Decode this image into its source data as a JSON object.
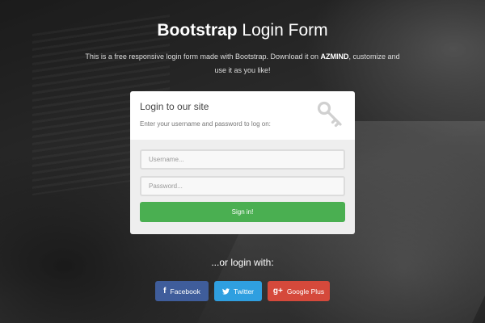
{
  "header": {
    "title_bold": "Bootstrap",
    "title_light": " Login Form",
    "description_prefix": "This is a free responsive login form made with Bootstrap. Download it on ",
    "description_brand": "AZMIND",
    "description_suffix": ", customize and use it as you like!"
  },
  "form": {
    "heading": "Login to our site",
    "subheading": "Enter your username and password to log on:",
    "icon": "key-icon",
    "username_placeholder": "Username...",
    "password_placeholder": "Password...",
    "submit_label": "Sign in!",
    "submit_color": "#4aaf51"
  },
  "social": {
    "label": "...or login with:",
    "buttons": [
      {
        "label": "Facebook",
        "icon": "facebook-icon",
        "color": "#3f5d9b"
      },
      {
        "label": "Twitter",
        "icon": "twitter-icon",
        "color": "#2f9fe0"
      },
      {
        "label": "Google Plus",
        "icon": "google-plus-icon",
        "color": "#d5493b"
      }
    ]
  }
}
